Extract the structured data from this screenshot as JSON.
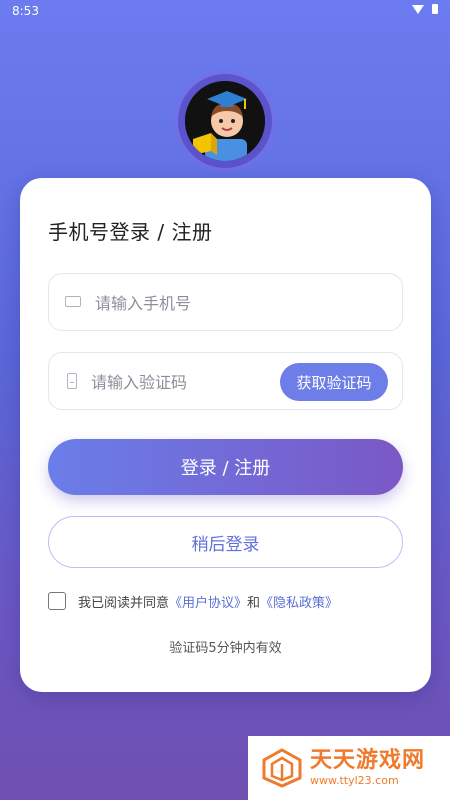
{
  "status_bar": {
    "time": "8:53"
  },
  "card": {
    "title": "手机号登录 / 注册",
    "phone_placeholder": "请输入手机号",
    "code_placeholder": "请输入验证码",
    "get_code_label": "获取验证码",
    "login_label": "登录 / 注册",
    "later_label": "稍后登录",
    "agree": {
      "prefix": "我已阅读并同意",
      "user_agreement": "《用户协议》",
      "and": "和",
      "privacy_policy": "《隐私政策》",
      "checked": false
    },
    "tip": "验证码5分钟内有效"
  },
  "watermark": {
    "main": "天天游戏网",
    "url": "www.ttyl23.com"
  },
  "colors": {
    "primary": "#6d7ee9",
    "gradient_end": "#7a58c6",
    "link": "#5a6fd6",
    "watermark": "#f07a2c"
  }
}
